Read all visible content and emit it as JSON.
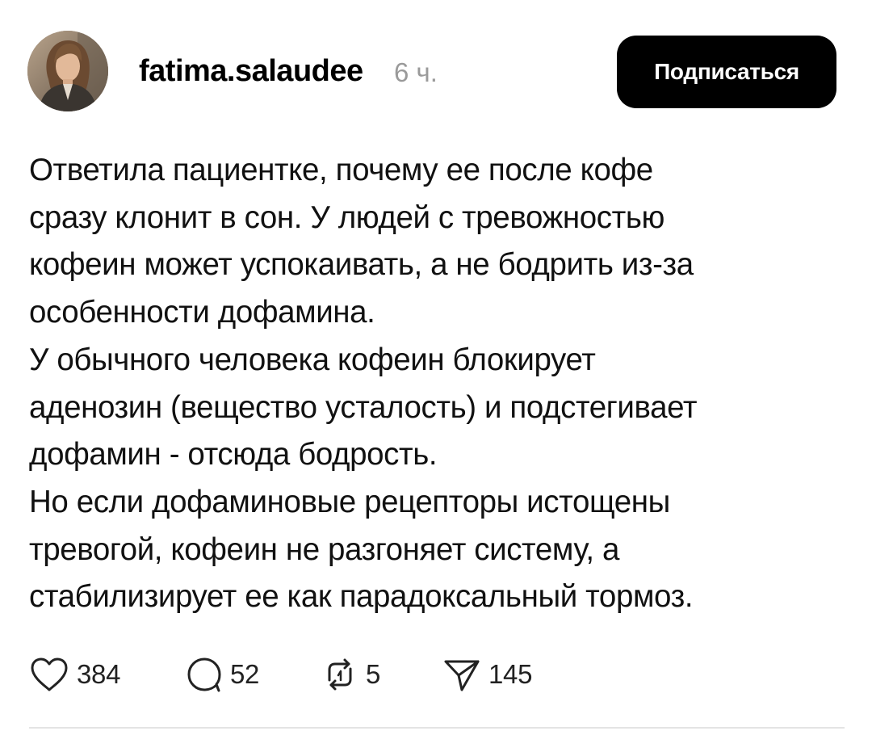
{
  "post": {
    "author": {
      "username": "fatima.salaudee",
      "time": "6 ч."
    },
    "follow_button": "Подписаться",
    "text_lines": [
      "Ответила пациентке, почему ее после кофе",
      "сразу клонит в сон. У людей с тревожностью",
      "кофеин может успокаивать, а не бодрить из-за",
      "особенности дофамина.",
      "У обычного человека кофеин блокирует",
      "аденозин (вещество усталость) и подстегивает",
      "дофамин - отсюда бодрость.",
      "Но если дофаминовые рецепторы истощены",
      "тревогой, кофеин не разгоняет систему, а",
      "стабилизирует ее как парадоксальный тормоз."
    ],
    "actions": {
      "likes": "384",
      "replies": "52",
      "reposts": "5",
      "shares": "145"
    }
  },
  "icons": {
    "like": "heart-icon",
    "reply": "speech-bubble-icon",
    "repost": "repost-arrows-icon",
    "share": "paper-plane-icon"
  },
  "colors": {
    "follow_button_bg": "#000000",
    "follow_button_text": "#ffffff",
    "timestamp": "#9a9a9a",
    "text": "#111111"
  }
}
